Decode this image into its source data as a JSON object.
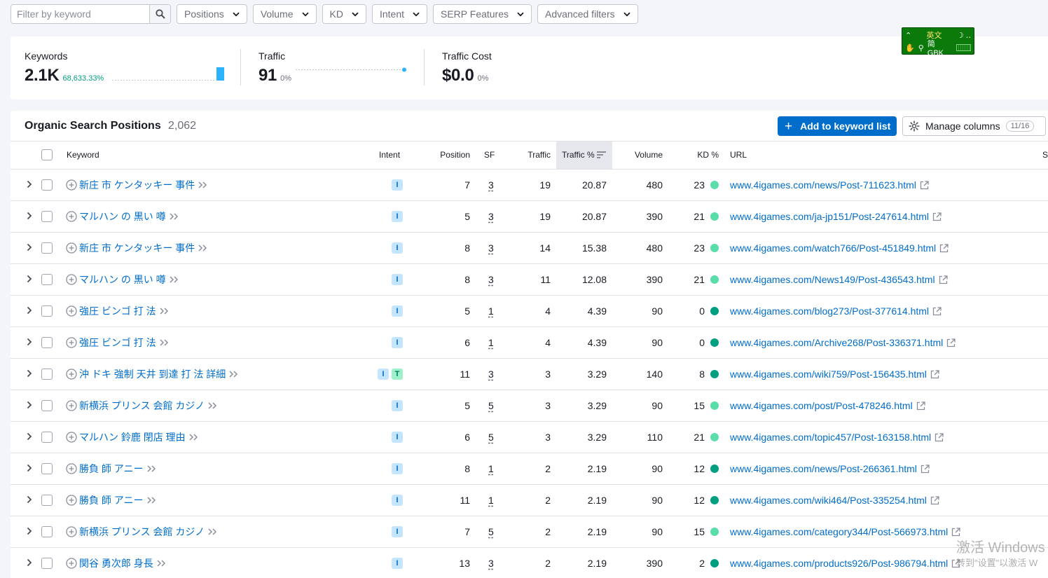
{
  "filters": {
    "search_placeholder": "Filter by keyword",
    "dropdowns": [
      "Positions",
      "Volume",
      "KD",
      "Intent",
      "SERP Features",
      "Advanced filters"
    ]
  },
  "summary": {
    "keywords": {
      "label": "Keywords",
      "value": "2.1K",
      "delta": "68,633.33%"
    },
    "traffic": {
      "label": "Traffic",
      "value": "91",
      "delta": "0%"
    },
    "traffic_cost": {
      "label": "Traffic Cost",
      "value": "$0.0",
      "delta": "0%"
    }
  },
  "ime": {
    "mode": "英文",
    "charset": "简 GBK"
  },
  "table": {
    "title": "Organic Search Positions",
    "count": "2,062",
    "add_button": "Add to keyword list",
    "manage_button": "Manage columns",
    "manage_badge": "11/16",
    "columns": {
      "keyword": "Keyword",
      "intent": "Intent",
      "position": "Position",
      "sf": "SF",
      "traffic": "Traffic",
      "traffic_pct": "Traffic %",
      "volume": "Volume",
      "kd": "KD %",
      "url": "URL",
      "extra": "S"
    },
    "rows": [
      {
        "keyword": "新庄 市 ケンタッキー 事件",
        "intent": [
          "I"
        ],
        "position": "7",
        "sf": "3",
        "traffic": "19",
        "traffic_pct": "20.87",
        "volume": "480",
        "kd": "23",
        "url": "www.4igames.com/news/Post-711623.html"
      },
      {
        "keyword": "マルハン の 黒い 噂",
        "intent": [
          "I"
        ],
        "position": "5",
        "sf": "3",
        "traffic": "19",
        "traffic_pct": "20.87",
        "volume": "390",
        "kd": "21",
        "url": "www.4igames.com/ja-jp151/Post-247614.html"
      },
      {
        "keyword": "新庄 市 ケンタッキー 事件",
        "intent": [
          "I"
        ],
        "position": "8",
        "sf": "3",
        "traffic": "14",
        "traffic_pct": "15.38",
        "volume": "480",
        "kd": "23",
        "url": "www.4igames.com/watch766/Post-451849.html"
      },
      {
        "keyword": "マルハン の 黒い 噂",
        "intent": [
          "I"
        ],
        "position": "8",
        "sf": "3",
        "traffic": "11",
        "traffic_pct": "12.08",
        "volume": "390",
        "kd": "21",
        "url": "www.4igames.com/News149/Post-436543.html"
      },
      {
        "keyword": "強圧 ビンゴ 打 法",
        "intent": [
          "I"
        ],
        "position": "5",
        "sf": "1",
        "traffic": "4",
        "traffic_pct": "4.39",
        "volume": "90",
        "kd": "0",
        "url": "www.4igames.com/blog273/Post-377614.html"
      },
      {
        "keyword": "強圧 ビンゴ 打 法",
        "intent": [
          "I"
        ],
        "position": "6",
        "sf": "1",
        "traffic": "4",
        "traffic_pct": "4.39",
        "volume": "90",
        "kd": "0",
        "url": "www.4igames.com/Archive268/Post-336371.html"
      },
      {
        "keyword": "沖 ドキ 強制 天井 到達 打 法 詳細",
        "intent": [
          "I",
          "T"
        ],
        "position": "11",
        "sf": "3",
        "traffic": "3",
        "traffic_pct": "3.29",
        "volume": "140",
        "kd": "8",
        "url": "www.4igames.com/wiki759/Post-156435.html"
      },
      {
        "keyword": "新横浜 プリンス 会館 カジノ",
        "intent": [
          "I"
        ],
        "position": "5",
        "sf": "5",
        "traffic": "3",
        "traffic_pct": "3.29",
        "volume": "90",
        "kd": "15",
        "url": "www.4igames.com/post/Post-478246.html"
      },
      {
        "keyword": "マルハン 鈴鹿 閉店 理由",
        "intent": [
          "I"
        ],
        "position": "6",
        "sf": "5",
        "traffic": "3",
        "traffic_pct": "3.29",
        "volume": "110",
        "kd": "21",
        "url": "www.4igames.com/topic457/Post-163158.html"
      },
      {
        "keyword": "勝負 師 アニー",
        "intent": [
          "I"
        ],
        "position": "8",
        "sf": "1",
        "traffic": "2",
        "traffic_pct": "2.19",
        "volume": "90",
        "kd": "12",
        "url": "www.4igames.com/news/Post-266361.html"
      },
      {
        "keyword": "勝負 師 アニー",
        "intent": [
          "I"
        ],
        "position": "11",
        "sf": "1",
        "traffic": "2",
        "traffic_pct": "2.19",
        "volume": "90",
        "kd": "12",
        "url": "www.4igames.com/wiki464/Post-335254.html"
      },
      {
        "keyword": "新横浜 プリンス 会館 カジノ",
        "intent": [
          "I"
        ],
        "position": "7",
        "sf": "5",
        "traffic": "2",
        "traffic_pct": "2.19",
        "volume": "90",
        "kd": "15",
        "url": "www.4igames.com/category344/Post-566973.html"
      },
      {
        "keyword": "関谷 勇次郎 身長",
        "intent": [
          "I"
        ],
        "position": "13",
        "sf": "3",
        "traffic": "2",
        "traffic_pct": "2.19",
        "volume": "390",
        "kd": "2",
        "url": "www.4igames.com/products926/Post-986794.html"
      }
    ]
  },
  "colors": {
    "accent": "#006dca",
    "kd_light": "#59dda9",
    "kd_dark": "#009f81",
    "sort_bg": "#e6e7ed"
  },
  "watermark": {
    "line1": "激活 Windows",
    "line2": "转到\"设置\"以激活 W"
  }
}
